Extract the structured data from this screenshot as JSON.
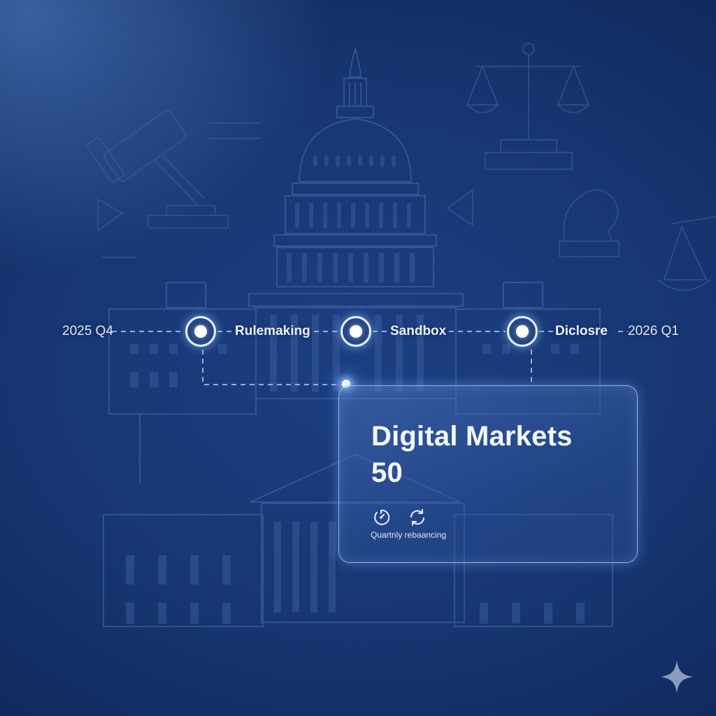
{
  "timeline": {
    "start_date": "2025 Q4",
    "end_date": "2026 Q1",
    "milestones": [
      {
        "label": "Rulemaking"
      },
      {
        "label": "Sandbox"
      },
      {
        "label": "Diclosre"
      }
    ]
  },
  "card": {
    "title": "Digital Markets\n50",
    "caption": "Quartnly rebaancing",
    "icons": [
      "timer-icon",
      "refresh-icon"
    ]
  },
  "decor": {
    "backdrop_icons": [
      "capitol-building-icon",
      "gavel-icon",
      "scales-of-justice-icon",
      "bust-icon"
    ],
    "corner_icon": "sparkle-icon"
  },
  "colors": {
    "background": "#173671",
    "accent": "#e8f1ff",
    "line": "#a9c4ee",
    "text": "#e9f0fb"
  }
}
